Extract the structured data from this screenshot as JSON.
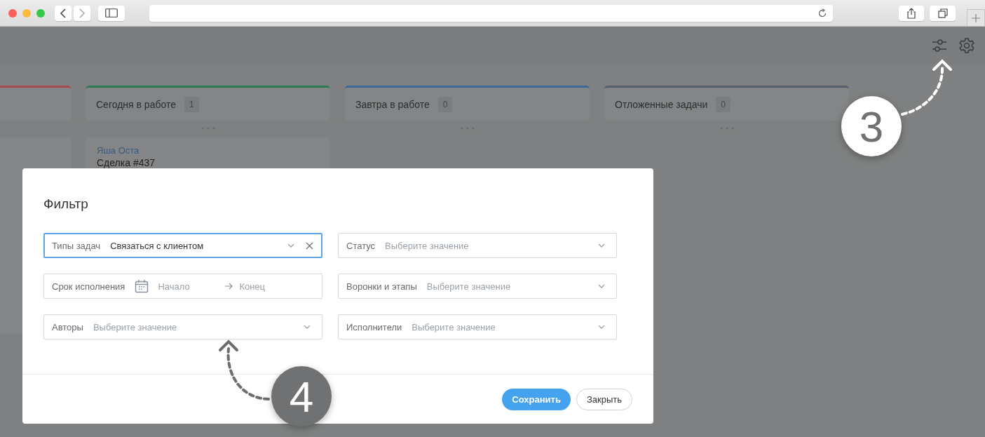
{
  "columns": [
    {
      "color": "#a44a4c",
      "cards": [
        {
          "kind": "blank"
        }
      ]
    },
    {
      "title": "Сегодня в работе",
      "count": "1",
      "color": "#2e7a55",
      "cards": [
        {
          "kind": "deal",
          "author": "Яша Оста",
          "deal": "Сделка #437"
        }
      ]
    },
    {
      "title": "Завтра в работе",
      "count": "0",
      "color": "#3d6896"
    },
    {
      "title": "Отложенные задачи",
      "count": "0",
      "color": "#55606a"
    }
  ],
  "filter": {
    "title": "Фильтр",
    "fields": [
      {
        "kind": "select",
        "label": "Типы задач",
        "value": "Связаться с клиентом",
        "focused": true,
        "clearable": true
      },
      {
        "kind": "select",
        "label": "Статус",
        "placeholder": "Выберите значение",
        "focused": false,
        "clearable": false
      },
      {
        "kind": "date-range",
        "label": "Срок исполнения",
        "start_placeholder": "Начало",
        "end_placeholder": "Конец",
        "focused": false
      },
      {
        "kind": "select",
        "label": "Воронки и этапы",
        "placeholder": "Выберите значение",
        "focused": false,
        "clearable": false
      },
      {
        "kind": "select",
        "label": "Авторы",
        "placeholder": "Выберите значение",
        "focused": false,
        "clearable": false
      },
      {
        "kind": "select",
        "label": "Исполнители",
        "placeholder": "Выберите значение",
        "focused": false,
        "clearable": false
      }
    ],
    "buttons": [
      {
        "kind": "primary",
        "label": "Сохранить"
      },
      {
        "kind": "secondary",
        "label": "Закрыть"
      }
    ]
  },
  "callouts": [
    {
      "kind": "light",
      "number": "3"
    },
    {
      "kind": "dark",
      "number": "4"
    }
  ]
}
